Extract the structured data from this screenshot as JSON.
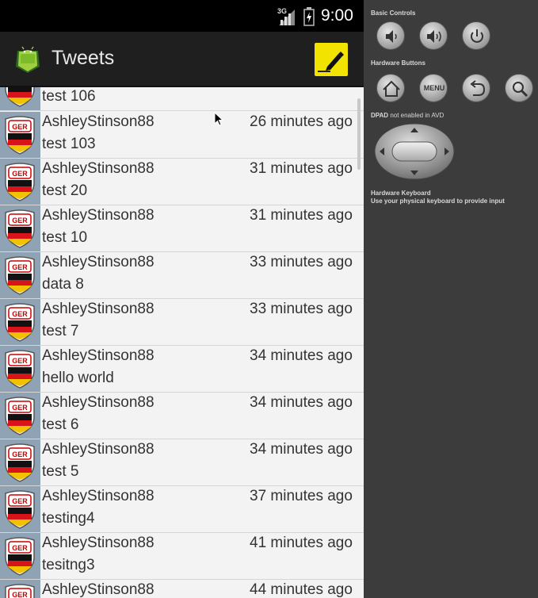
{
  "status_bar": {
    "network": "3G",
    "time": "9:00"
  },
  "action_bar": {
    "title": "Tweets",
    "app_icon": "android-icon",
    "compose_icon": "compose-pencil-icon"
  },
  "first_partial_message": "test 106",
  "tweets": [
    {
      "user": "AshleyStinson88",
      "time": "26 minutes ago",
      "message": "test 103"
    },
    {
      "user": "AshleyStinson88",
      "time": "31 minutes ago",
      "message": "test 20"
    },
    {
      "user": "AshleyStinson88",
      "time": "31 minutes ago",
      "message": "test 10"
    },
    {
      "user": "AshleyStinson88",
      "time": "33 minutes ago",
      "message": "data 8"
    },
    {
      "user": "AshleyStinson88",
      "time": "33 minutes ago",
      "message": "test 7"
    },
    {
      "user": "AshleyStinson88",
      "time": "34 minutes ago",
      "message": "hello world"
    },
    {
      "user": "AshleyStinson88",
      "time": "34 minutes ago",
      "message": "test 6"
    },
    {
      "user": "AshleyStinson88",
      "time": "34 minutes ago",
      "message": "test 5"
    },
    {
      "user": "AshleyStinson88",
      "time": "37 minutes ago",
      "message": "testing4"
    },
    {
      "user": "AshleyStinson88",
      "time": "41 minutes ago",
      "message": "tesitng3"
    },
    {
      "user": "AshleyStinson88",
      "time": "44 minutes ago",
      "message": ""
    }
  ],
  "avatar_badge_text": "GER",
  "emulator": {
    "basic_controls_label": "Basic Controls",
    "hardware_buttons_label": "Hardware Buttons",
    "menu_label": "MENU",
    "dpad_label": "DPAD",
    "dpad_note": "not enabled in AVD",
    "keyboard_label": "Hardware Keyboard",
    "keyboard_note": "Use your physical keyboard to provide input"
  },
  "colors": {
    "compose_accent": "#f3e300",
    "list_background": "#f3f3f3",
    "emulator_panel": "#3c3c3c"
  }
}
